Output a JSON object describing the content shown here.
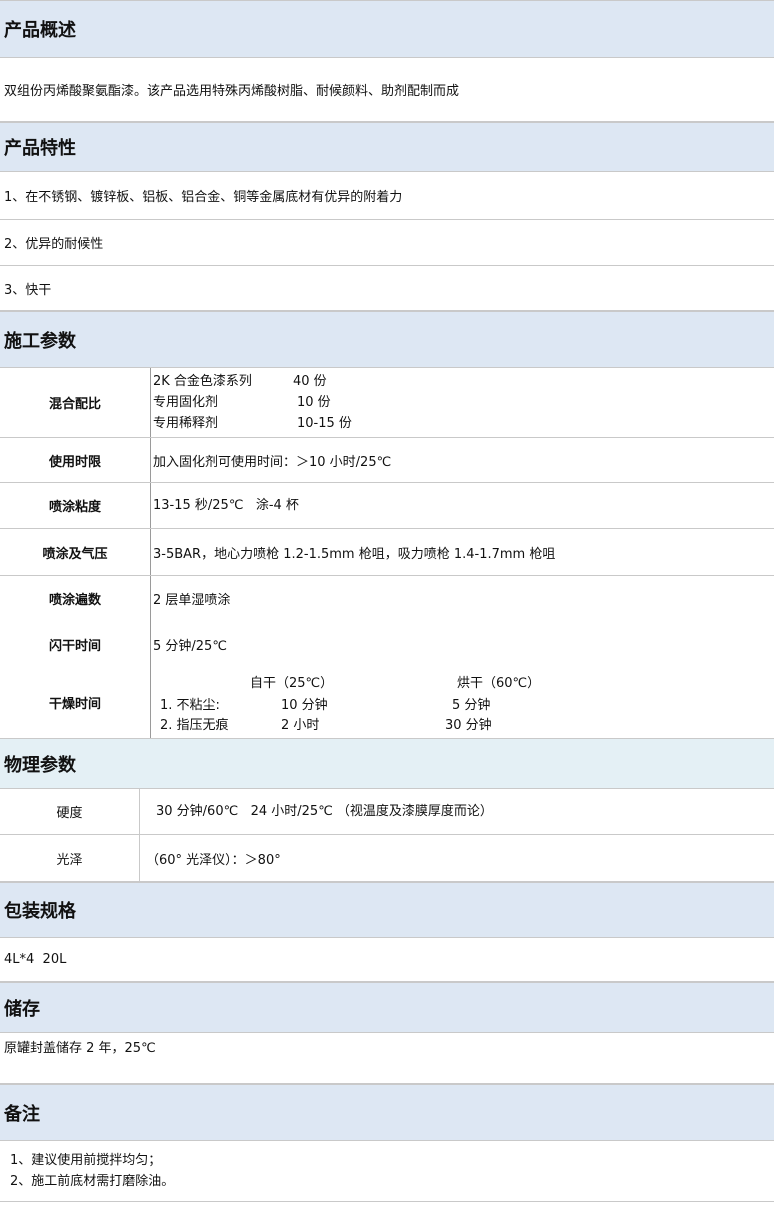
{
  "overview": {
    "heading": "产品概述",
    "text": "双组份丙烯酸聚氨酯漆。该产品选用特殊丙烯酸树脂、耐候颜料、助剂配制而成"
  },
  "features": {
    "heading": "产品特性",
    "items": [
      "1、在不锈钢、镀锌板、铝板、铝合金、铜等金属底材有优异的附着力",
      "2、优异的耐候性",
      "3、快干"
    ]
  },
  "construction": {
    "heading": "施工参数",
    "mixing": {
      "label": "混合配比",
      "lines": [
        {
          "name": "2K 合金色漆系列",
          "amount": "40 份"
        },
        {
          "name": "专用固化剂",
          "amount": "10 份"
        },
        {
          "name": "专用稀释剂",
          "amount": "10-15 份"
        }
      ]
    },
    "pot_life": {
      "label": "使用时限",
      "value": "加入固化剂可使用时间：＞10 小时/25℃"
    },
    "viscosity": {
      "label": "喷涂粘度",
      "value": "13-15 秒/25℃   涂-4 杯"
    },
    "spray_pressure": {
      "label": "喷涂及气压",
      "value": "3-5BAR，地心力喷枪 1.2-1.5mm 枪咀，吸力喷枪 1.4-1.7mm 枪咀"
    },
    "coats": {
      "label": "喷涂遍数",
      "value": "2 层单湿喷涂"
    },
    "flash_time": {
      "label": "闪干时间",
      "value": "5 分钟/25℃"
    },
    "drying": {
      "label": "干燥时间",
      "col_air": "自干（25℃）",
      "col_bake": "烘干（60℃）",
      "rows": [
        {
          "name": "1. 不粘尘:",
          "air": "10 分钟",
          "bake": "5 分钟"
        },
        {
          "name": "2. 指压无痕",
          "air": "2 小时",
          "bake": "30 分钟"
        }
      ]
    }
  },
  "physical": {
    "heading": "物理参数",
    "hardness": {
      "label": "硬度",
      "value": "30 分钟/60℃   24 小时/25℃ （视温度及漆膜厚度而论）"
    },
    "gloss": {
      "label": "光泽",
      "value": "（60° 光泽仪）：＞80°"
    }
  },
  "packaging": {
    "heading": "包装规格",
    "value": "4L*4  20L"
  },
  "storage": {
    "heading": "储存",
    "value": "原罐封盖储存 2 年，25℃"
  },
  "notes": {
    "heading": "备注",
    "items": [
      "1、建议使用前搅拌均匀；",
      "2、施工前底材需打磨除油。"
    ]
  }
}
